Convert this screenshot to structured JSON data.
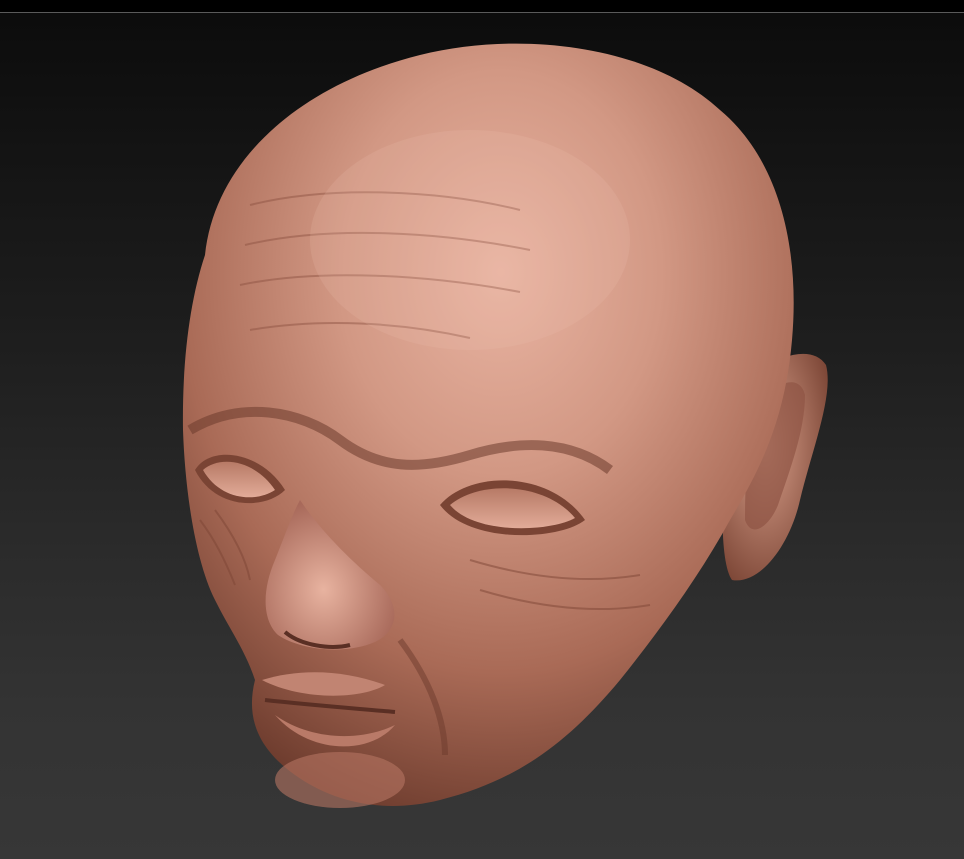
{
  "canvas": {
    "background_top": "#0b0b0b",
    "background_bottom": "#373737",
    "border_color": "#5a5a5a"
  },
  "model": {
    "subject": "sculpted-head",
    "material_color": "#c88a78",
    "highlight_color": "#e9b4a2",
    "shadow_color": "#5a2f24"
  }
}
